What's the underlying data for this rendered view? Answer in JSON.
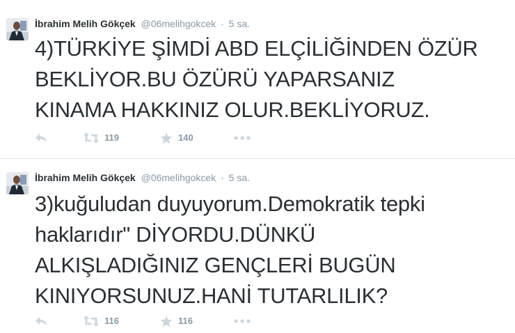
{
  "tweets": [
    {
      "author": {
        "fullname": "İbrahim Melih Gökçek",
        "username": "@06melihgokcek"
      },
      "separator": "·",
      "timestamp": "5 sa.",
      "text_lines": [
        "4)TÜRKİYE ŞİMDİ ABD ELÇİLİĞİNDEN ÖZÜR",
        "BEKLİYOR.BU ÖZÜRÜ YAPARSANIZ",
        "KINAMA HAKKINIZ OLUR.BEKLİYORUZ."
      ],
      "actions": {
        "reply_icon": "reply-icon",
        "retweet_icon": "retweet-icon",
        "retweet_count": "119",
        "favorite_icon": "star-icon",
        "favorite_count": "140",
        "more_icon": "more-dots-icon"
      }
    },
    {
      "author": {
        "fullname": "İbrahim Melih Gökçek",
        "username": "@06melihgokcek"
      },
      "separator": "·",
      "timestamp": "5 sa.",
      "text_lines": [
        "3)kuğuludan duyuyorum.Demokratik tepki",
        "haklarıdır\" DİYORDU.DÜNKÜ",
        "ALKIŞLADIĞINIZ GENÇLERİ BUGÜN",
        "KINIYORSUNUZ.HANİ TUTARLILIK?"
      ],
      "actions": {
        "reply_icon": "reply-icon",
        "retweet_icon": "retweet-icon",
        "retweet_count": "116",
        "favorite_icon": "star-icon",
        "favorite_count": "116",
        "more_icon": "more-dots-icon"
      }
    }
  ],
  "colors": {
    "text": "#292f33",
    "muted": "#8899a6",
    "icon": "#ccd6dd",
    "divider": "#e1e8ed"
  }
}
